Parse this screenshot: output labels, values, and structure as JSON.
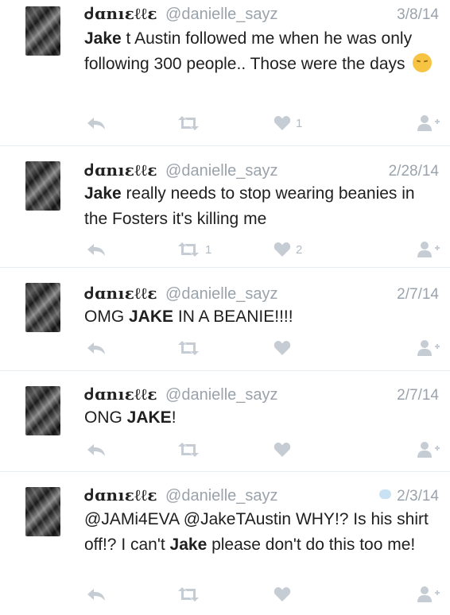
{
  "tweets": [
    {
      "name": "ᑯɑnıεℓℓε",
      "handle": "@danielle_sayz",
      "date": "3/8/14",
      "segments": [
        {
          "b": true,
          "t": "Jake"
        },
        {
          "b": false,
          "t": " t Austin followed me when he was only following 300 people.. Those were the days "
        }
      ],
      "emoji": "pensive-face-emoji",
      "counts": {
        "retweets": "",
        "likes": "1"
      }
    },
    {
      "name": "ᑯɑnıεℓℓε",
      "handle": "@danielle_sayz",
      "date": "2/28/14",
      "segments": [
        {
          "b": true,
          "t": "Jake"
        },
        {
          "b": false,
          "t": " really needs to stop wearing beanies in the Fosters it's killing me"
        }
      ],
      "counts": {
        "retweets": "1",
        "likes": "2"
      }
    },
    {
      "name": "ᑯɑnıεℓℓε",
      "handle": "@danielle_sayz",
      "date": "2/7/14",
      "segments": [
        {
          "b": false,
          "t": "OMG "
        },
        {
          "b": true,
          "t": "JAKE"
        },
        {
          "b": false,
          "t": " IN A BEANIE!!!!"
        }
      ],
      "counts": {
        "retweets": "",
        "likes": ""
      }
    },
    {
      "name": "ᑯɑnıεℓℓε",
      "handle": "@danielle_sayz",
      "date": "2/7/14",
      "segments": [
        {
          "b": false,
          "t": "ONG "
        },
        {
          "b": true,
          "t": "JAKE"
        },
        {
          "b": false,
          "t": "!"
        }
      ],
      "counts": {
        "retweets": "",
        "likes": ""
      }
    },
    {
      "name": "ᑯɑnıεℓℓε",
      "handle": "@danielle_sayz",
      "date": "2/3/14",
      "conversation_icon": "speech-bubble-icon",
      "segments": [
        {
          "b": false,
          "t": "@JAMi4EVA @JakeTAustin WHY!? Is his shirt off!? I can't "
        },
        {
          "b": true,
          "t": "Jake"
        },
        {
          "b": false,
          "t": " please don't do this too me!"
        }
      ],
      "counts": {
        "retweets": "",
        "likes": ""
      }
    }
  ],
  "colors": {
    "action_icon": "#c5ccd3",
    "meta_text": "#9aa3ab",
    "divider": "#e6ecf0"
  }
}
